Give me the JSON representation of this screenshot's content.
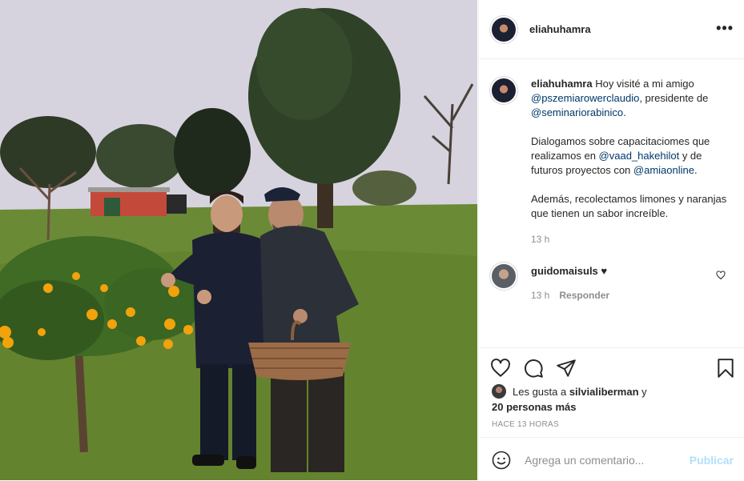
{
  "post": {
    "username": "eliahuhamra",
    "more_label": "•••",
    "caption": {
      "p1_text1": " Hoy visité a mi amigo ",
      "mention1": "@pszemiarowerclaudio",
      "p1_text2": ", presidente de ",
      "mention2": "@seminariorabinico",
      "p1_text3": ".",
      "p2_text1": "Dialogamos sobre capacitaciomes que realizamos en ",
      "mention3": "@vaad_hakehilot",
      "p2_text2": " y de futuros proyectos con ",
      "mention4": "@amiaonline",
      "p2_text3": ".",
      "p3": "Además, recolectamos limones y naranjas que tienen un sabor increíble.",
      "time": "13 h"
    },
    "comment": {
      "username": "guidomaisuls",
      "text": " ♥",
      "time": "13 h",
      "reply_label": "Responder"
    },
    "likes": {
      "prefix": "Les gusta a ",
      "user": "silvialiberman",
      "and": " y",
      "others": "20 personas más"
    },
    "time_ago": "HACE 13 HORAS",
    "add_comment": {
      "placeholder": "Agrega un comentario...",
      "publish_label": "Publicar"
    },
    "icons": {
      "like": "heart-icon",
      "comment": "comment-icon",
      "share": "send-icon",
      "save": "bookmark-icon",
      "emoji": "smile-icon"
    },
    "colors": {
      "mention": "#00376b",
      "muted": "#8e8e8e",
      "publish_disabled": "#b2dffc"
    }
  }
}
